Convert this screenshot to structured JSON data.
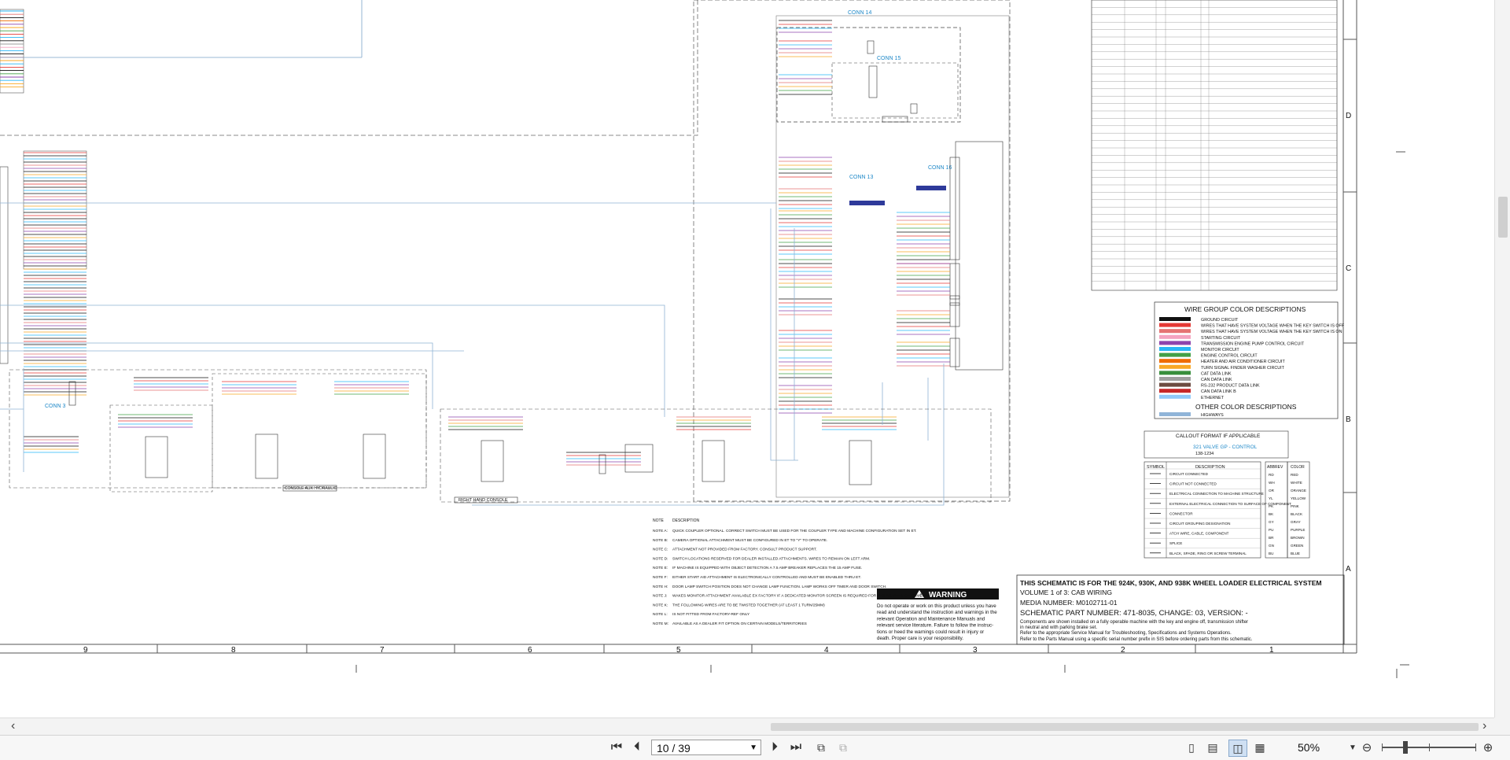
{
  "schematic": {
    "column_numbers": [
      "9",
      "8",
      "7",
      "6",
      "5",
      "4",
      "3",
      "2",
      "1"
    ],
    "row_letters": [
      "D",
      "C",
      "B",
      "A"
    ],
    "connector_labels": {
      "conn14": "CONN 14",
      "conn15": "CONN 15",
      "conn13": "CONN 13",
      "conn16": "CONN 16",
      "conn3": "CONN 3"
    },
    "box_labels": {
      "console_aux_hydraulic": "CONSOLE AUX HYDRAULIC",
      "right_hand_console": "RIGHT HAND CONSOLE"
    },
    "wire_group_title": "WIRE GROUP COLOR DESCRIPTIONS",
    "wire_groups": [
      {
        "color": "#111111",
        "label": "GROUND CIRCUIT"
      },
      {
        "color": "#e53935",
        "label": "WIRES THAT HAVE SYSTEM VOLTAGE WHEN THE KEY SWITCH IS OFF"
      },
      {
        "color": "#e57373",
        "label": "WIRES THAT HAVE SYSTEM VOLTAGE WHEN THE KEY SWITCH IS ON"
      },
      {
        "color": "#f4a3c0",
        "label": "STARTING CIRCUIT"
      },
      {
        "color": "#8e44ad",
        "label": "TRANSMISSION ENGINE PUMP CONTROL CIRCUIT"
      },
      {
        "color": "#29b6f6",
        "label": "MONITOR CIRCUIT"
      },
      {
        "color": "#43a047",
        "label": "ENGINE CONTROL CIRCUIT"
      },
      {
        "color": "#ef6c00",
        "label": "HEATER AND AIR CONDITIONER CIRCUIT"
      },
      {
        "color": "#f9a825",
        "label": "TURN SIGNAL FINDER WASHER CIRCUIT"
      },
      {
        "color": "#388e3c",
        "label": "CAT DATA LINK"
      },
      {
        "color": "#9e9e9e",
        "label": "CAN DATA LINK"
      },
      {
        "color": "#6d4c41",
        "label": "RS-232 PRODUCT DATA LINK"
      },
      {
        "color": "#c62828",
        "label": "CAN DATA LINK B"
      },
      {
        "color": "#90caf9",
        "label": "ETHERNET"
      }
    ],
    "other_color_title": "OTHER COLOR DESCRIPTIONS",
    "other_colors": [
      {
        "color": "#90b4d8",
        "label": "HIGHWAYS"
      }
    ],
    "callout_title": "CALLOUT FORMAT IF APPLICABLE",
    "callout_example": "321 VALVE GP - CONTROL",
    "callout_number": "138-1234",
    "symbol_header": [
      "SYMBOL",
      "DESCRIPTION"
    ],
    "symbols": [
      "CIRCUIT CONNECTED",
      "CIRCUIT NOT CONNECTED",
      "ELECTRICAL CONNECTION TO MACHINE STRUCTURE",
      "EXTERNAL ELECTRICAL CONNECTION TO SURFACE OF COMPONENT",
      "CONNECTOR",
      "CIRCUIT GROUPING DESIGNATION",
      "ATCH WIRE, CABLE, COMPONENT",
      "SPLICE",
      "BLACK, SPADE, RING OR SCREW TERMINAL"
    ],
    "color_header": [
      "ABBREV",
      "COLOR"
    ],
    "color_abbrevs": [
      [
        "RD",
        "RED"
      ],
      [
        "WH",
        "WHITE"
      ],
      [
        "OR",
        "ORANGE"
      ],
      [
        "YL",
        "YELLOW"
      ],
      [
        "PK",
        "PINK"
      ],
      [
        "BK",
        "BLACK"
      ],
      [
        "GY",
        "GRAY"
      ],
      [
        "PU",
        "PURPLE"
      ],
      [
        "BR",
        "BROWN"
      ],
      [
        "GN",
        "GREEN"
      ],
      [
        "BU",
        "BLUE"
      ]
    ],
    "title_block": {
      "line1": "THIS SCHEMATIC IS FOR THE 924K, 930K, AND 938K WHEEL LOADER ELECTRICAL SYSTEM",
      "line2": "VOLUME 1 of 3: CAB WIRING",
      "line3": "MEDIA NUMBER: M0102711-01",
      "line4": "SCHEMATIC PART NUMBER: 471-8035, CHANGE: 03, VERSION: -",
      "line5": "Components are shown installed on a fully operable machine with the key and engine off, transmission shifter",
      "line6": "in neutral and with parking brake set.",
      "line7": "Refer to the appropriate Service Manual for Troubleshooting, Specifications and Systems Operations.",
      "line8": "Refer to the Parts Manual using a specific serial number prefix in SIS before ordering parts from this schematic."
    },
    "warning_title": "WARNING",
    "warning_lines": [
      "Do not operate or work on this product unless you have",
      "read and understand the instruction and warnings in the",
      "relevant Operation and Maintenance Manuals and",
      "relevant service literature. Failure to follow the instruc-",
      "tions or heed the warnings could result in injury or",
      "death. Proper care is your responsibility."
    ],
    "notes_header": [
      "NOTE",
      "DESCRIPTION"
    ],
    "notes": [
      [
        "NOTE A:",
        "QUICK COUPLER OPTIONAL. CORRECT SWITCH MUST BE USED FOR THE COUPLER TYPE AND MACHINE CONFIGURATION SET IN ET."
      ],
      [
        "NOTE B:",
        "CAMERA OPTIONAL ATTACHMENT MUST BE CONFIGURED IN ET TO \"Y\" TO OPERATE."
      ],
      [
        "NOTE C:",
        "ATTACHMENT NOT PROVIDED FROM FACTORY. CONSULT PRODUCT SUPPORT."
      ],
      [
        "NOTE D:",
        "SWITCH LOCATIONS RESERVED FOR DEALER INSTALLED ATTACHMENTS. WIRES TO REMAIN ON LEFT ARM."
      ],
      [
        "NOTE E:",
        "IF MACHINE IS EQUIPPED WITH OBJECT DETECTION A 7.5 AMP BREAKER REPLACES THE 15 AMP FUSE."
      ],
      [
        "NOTE F:",
        "EITHER START AID ATTACHMENT IS ELECTRONICALLY CONTROLLED AND MUST BE ENABLED THRU ET."
      ],
      [
        "NOTE H:",
        "DOOR LAMP SWITCH POSITION DOES NOT CHANGE LAMP FUNCTION. LAMP WORKS OFF TIMER AND DOOR SWITCH."
      ],
      [
        "NOTE J:",
        "WAKES MONITOR ATTACHMENT AVAILABLE EX FACTORY IF A DEDICATED MONITOR SCREEN IS REQUIRED FOR THE REAR VISION CAMERA."
      ],
      [
        "NOTE K:",
        "THE FOLLOWING WIRES ARE TO BE TWISTED TOGETHER (AT LEAST 1 TURN/25MM)"
      ],
      [
        "NOTE L:",
        "IS NOT FITTED FROM FACTORY-REF ONLY"
      ],
      [
        "NOTE M:",
        "AVAILABLE AS A DEALER FIT OPTION ON CERTAIN MODELS/TERRITORIES"
      ]
    ]
  },
  "viewer": {
    "page_indicator": "10 / 39",
    "zoom_level": "50%",
    "zoom_fraction": 0.25
  }
}
